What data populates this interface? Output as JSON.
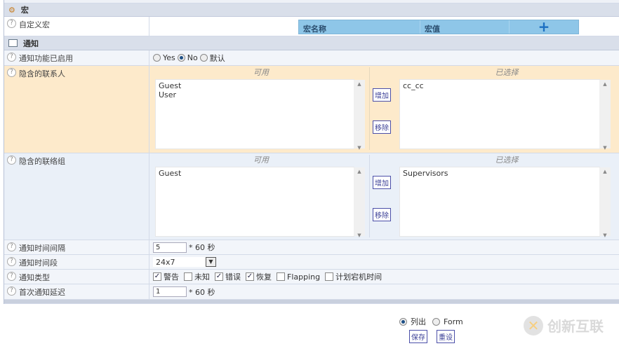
{
  "macro_section": {
    "title": "宏",
    "custom_label": "自定义宏",
    "col_name": "宏名称",
    "col_value": "宏值",
    "add": "+"
  },
  "notify_section": {
    "title": "通知",
    "enabled": {
      "label": "通知功能已启用",
      "options": [
        "Yes",
        "No",
        "默认"
      ],
      "selected": "No"
    },
    "contacts": {
      "label": "隐含的联系人",
      "available_title": "可用",
      "selected_title": "已选择",
      "available": [
        "Guest",
        "User"
      ],
      "selected": [
        "cc_cc"
      ],
      "add": "增加",
      "remove": "移除"
    },
    "groups": {
      "label": "隐含的联络组",
      "available_title": "可用",
      "selected_title": "已选择",
      "available": [
        "Guest"
      ],
      "selected": [
        "Supervisors"
      ],
      "add": "增加",
      "remove": "移除"
    },
    "interval": {
      "label": "通知时间间隔",
      "value": "5",
      "unit": "* 60 秒"
    },
    "period": {
      "label": "通知时间段",
      "value": "24x7"
    },
    "types": {
      "label": "通知类型",
      "options": [
        {
          "label": "警告",
          "checked": true
        },
        {
          "label": "未知",
          "checked": false
        },
        {
          "label": "错误",
          "checked": true
        },
        {
          "label": "恢复",
          "checked": true
        },
        {
          "label": "Flapping",
          "checked": false
        },
        {
          "label": "计划宕机时间",
          "checked": false
        }
      ]
    },
    "first_delay": {
      "label": "首次通知延迟",
      "value": "1",
      "unit": "* 60 秒"
    }
  },
  "footer": {
    "mode_options": [
      "列出",
      "Form"
    ],
    "mode_selected": "列出",
    "save": "保存",
    "reset": "重设"
  },
  "watermark": "创新互联"
}
